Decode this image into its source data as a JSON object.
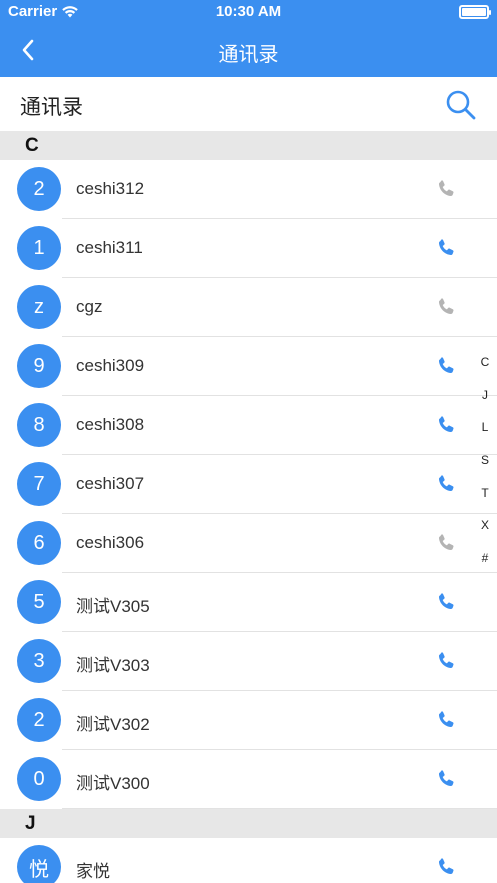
{
  "status": {
    "carrier": "Carrier",
    "time": "10:30 AM"
  },
  "nav": {
    "title": "通讯录"
  },
  "header": {
    "title": "通讯录"
  },
  "sections": [
    {
      "letter": "C",
      "contacts": [
        {
          "avatar": "2",
          "name": "ceshi312",
          "phone_active": false
        },
        {
          "avatar": "1",
          "name": "ceshi311",
          "phone_active": true
        },
        {
          "avatar": "z",
          "name": "cgz",
          "phone_active": false
        },
        {
          "avatar": "9",
          "name": "ceshi309",
          "phone_active": true
        },
        {
          "avatar": "8",
          "name": "ceshi308",
          "phone_active": true
        },
        {
          "avatar": "7",
          "name": "ceshi307",
          "phone_active": true
        },
        {
          "avatar": "6",
          "name": "ceshi306",
          "phone_active": false
        },
        {
          "avatar": "5",
          "name": "测试V305",
          "phone_active": true
        },
        {
          "avatar": "3",
          "name": "测试V303",
          "phone_active": true
        },
        {
          "avatar": "2",
          "name": "测试V302",
          "phone_active": true
        },
        {
          "avatar": "0",
          "name": "测试V300",
          "phone_active": true
        }
      ]
    },
    {
      "letter": "J",
      "contacts": [
        {
          "avatar": "悦",
          "name": "家悦",
          "phone_active": true
        }
      ]
    }
  ],
  "index_letters": [
    "C",
    "J",
    "L",
    "S",
    "T",
    "X",
    "#"
  ],
  "colors": {
    "accent": "#3b8ff0",
    "phone_active": "#3b8ff0",
    "phone_inactive": "#b4b4b4",
    "section_bg": "#e7e7e7"
  },
  "icons": {
    "back": "chevron-left-icon",
    "search": "search-icon",
    "phone": "phone-icon",
    "wifi": "wifi-icon",
    "battery": "battery-icon"
  }
}
